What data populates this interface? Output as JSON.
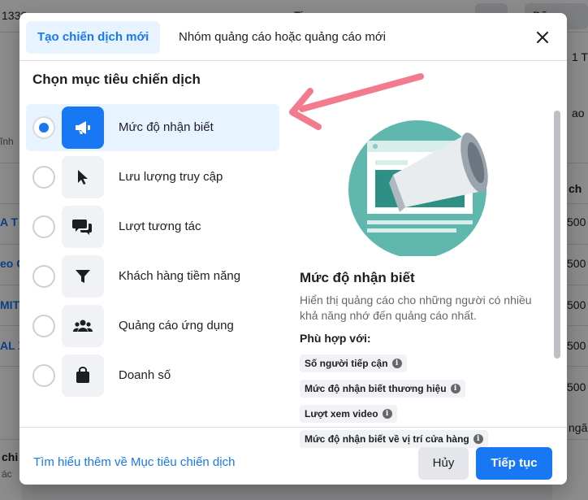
{
  "background": {
    "fragments": [
      "1336  ",
      "Ti",
      "Đã",
      "ĩnh",
      "A T",
      "eo C",
      "MIT",
      "AL X",
      "chi",
      "ác",
      "500",
      "500",
      "500",
      "500",
      "500",
      "ch",
      "1 T",
      "ao",
      "ngã"
    ]
  },
  "modal": {
    "tabs": [
      {
        "label": "Tạo chiến dịch mới",
        "active": true
      },
      {
        "label": "Nhóm quảng cáo hoặc quảng cáo mới",
        "active": false
      }
    ],
    "close_icon": "close-icon",
    "section_title": "Chọn mục tiêu chiến dịch",
    "objectives": [
      {
        "label": "Mức độ nhận biết",
        "icon": "megaphone-icon",
        "selected": true
      },
      {
        "label": "Lưu lượng truy cập",
        "icon": "cursor-icon",
        "selected": false
      },
      {
        "label": "Lượt tương tác",
        "icon": "chat-bubbles-icon",
        "selected": false
      },
      {
        "label": "Khách hàng tiềm năng",
        "icon": "funnel-icon",
        "selected": false
      },
      {
        "label": "Quảng cáo ứng dụng",
        "icon": "people-icon",
        "selected": false
      },
      {
        "label": "Doanh số",
        "icon": "shopping-bag-icon",
        "selected": false
      }
    ],
    "detail": {
      "title": "Mức độ nhận biết",
      "description": "Hiển thị quảng cáo cho những người có nhiều khả năng nhớ đến quảng cáo nhất.",
      "fit_label": "Phù hợp với:",
      "chips": [
        "Số người tiếp cận",
        "Mức độ nhận biết thương hiệu",
        "Lượt xem video",
        "Mức độ nhận biết về vị trí cửa hàng"
      ]
    },
    "footer": {
      "learn_more": "Tìm hiểu thêm về Mục tiêu chiến dịch",
      "cancel": "Hủy",
      "continue": "Tiếp tục"
    }
  },
  "colors": {
    "accent": "#1877f2",
    "selected_bg": "#e7f3ff",
    "annotation_arrow": "#f27b8e",
    "illustration_teal": "#5fb7ad"
  }
}
